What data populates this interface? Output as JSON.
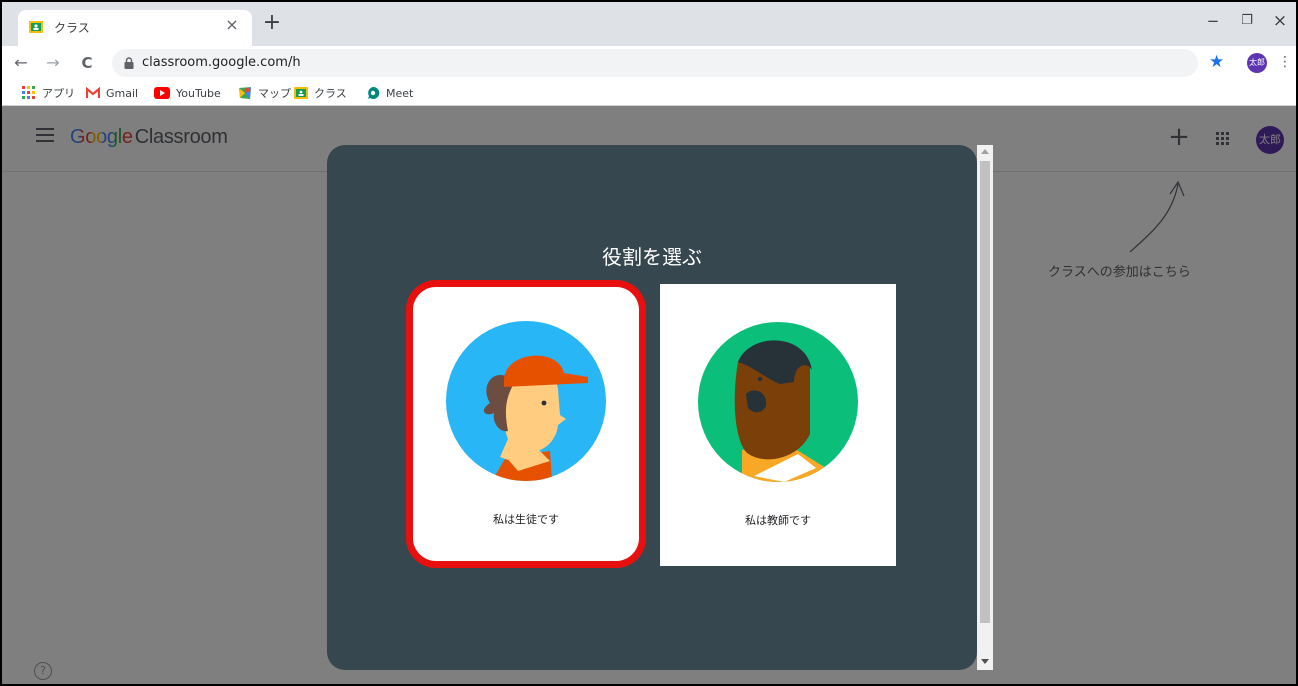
{
  "browser": {
    "tab": {
      "title": "クラス",
      "close_label": "×"
    },
    "new_tab_label": "+",
    "window_controls": {
      "minimize": "−",
      "restore": "❐",
      "close": "×"
    },
    "nav": {
      "back": "←",
      "forward": "→",
      "reload": "C"
    },
    "url": "classroom.google.com/h",
    "profile_initials": "太郎",
    "menu_label": "⋮",
    "bookmarks": [
      {
        "label": "アプリ",
        "icon": "apps-grid-icon"
      },
      {
        "label": "Gmail",
        "icon": "gmail-icon"
      },
      {
        "label": "YouTube",
        "icon": "youtube-icon"
      },
      {
        "label": "マップ",
        "icon": "maps-icon"
      },
      {
        "label": "クラス",
        "icon": "classroom-icon"
      },
      {
        "label": "Meet",
        "icon": "meet-icon"
      }
    ]
  },
  "appbar": {
    "brand_google": "Google",
    "brand_product": "Classroom",
    "add_label": "+",
    "avatar_initials": "太郎"
  },
  "hint": {
    "text": "クラスへの参加はこちら"
  },
  "help_label": "?",
  "dialog": {
    "title": "役割を選ぶ",
    "roles": [
      {
        "label": "私は生徒です",
        "highlighted": true
      },
      {
        "label": "私は教師です",
        "highlighted": false
      }
    ]
  },
  "colors": {
    "dialog_bg": "#37474f",
    "highlight": "#e8100f",
    "student_circle": "#29b6f6",
    "teacher_circle": "#0bbf7a",
    "avatar": "#5e35b1"
  }
}
